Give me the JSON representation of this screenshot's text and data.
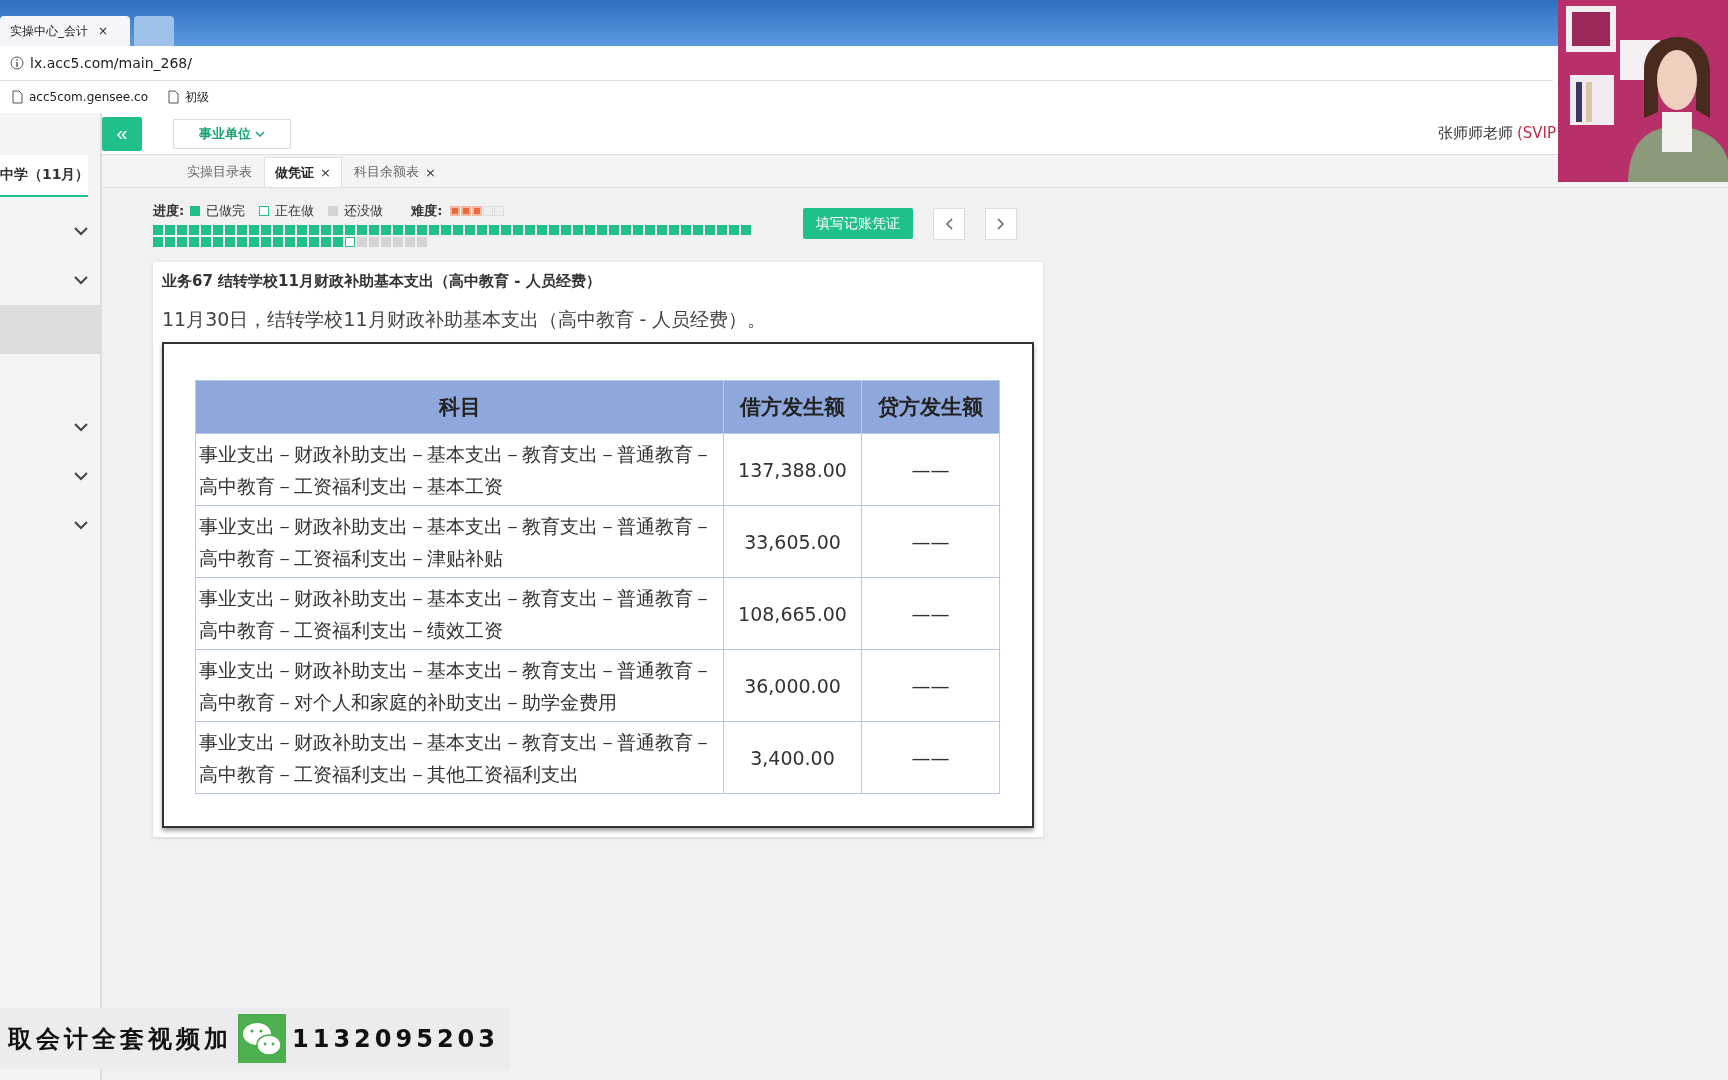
{
  "browser": {
    "tabs": [
      {
        "title": "实操中心_会计",
        "close": "×",
        "selected": true
      },
      {
        "selected": false
      }
    ],
    "address": "lx.acc5.com/main_268/",
    "bookmarks": [
      {
        "label": "acc5com.gensee.co"
      },
      {
        "label": "初级"
      }
    ]
  },
  "header": {
    "collapse": "«",
    "unit_dropdown": "事业单位",
    "user": "张师师老师",
    "membership": "(SVIP"
  },
  "sidebar": {
    "title": "中学（11月）",
    "items": [
      {
        "kind": "group",
        "selected": false
      },
      {
        "kind": "group",
        "selected": false
      },
      {
        "kind": "plain",
        "selected": true
      },
      {
        "kind": "group",
        "selected": false
      },
      {
        "kind": "group",
        "selected": false
      },
      {
        "kind": "group",
        "selected": false
      }
    ]
  },
  "tabs": [
    {
      "label": "实操目录表",
      "selected": false
    },
    {
      "label": "做凭证",
      "close": "×",
      "selected": true
    },
    {
      "label": "科目余额表",
      "close": "×",
      "selected": false
    }
  ],
  "progress": {
    "label": "进度:",
    "legend": [
      {
        "kind": "done",
        "label": "已做完"
      },
      {
        "kind": "current",
        "label": "正在做"
      },
      {
        "kind": "todo",
        "label": "还没做"
      }
    ],
    "difficulty_label": "难度:",
    "stars": 3,
    "squares": [
      {
        "kind": "done"
      },
      {
        "kind": "done"
      },
      {
        "kind": "done"
      },
      {
        "kind": "done"
      },
      {
        "kind": "done"
      },
      {
        "kind": "done"
      },
      {
        "kind": "done"
      },
      {
        "kind": "done"
      },
      {
        "kind": "done"
      },
      {
        "kind": "done"
      },
      {
        "kind": "done"
      },
      {
        "kind": "done"
      },
      {
        "kind": "done"
      },
      {
        "kind": "done"
      },
      {
        "kind": "done"
      },
      {
        "kind": "done"
      },
      {
        "kind": "done"
      },
      {
        "kind": "done"
      },
      {
        "kind": "done"
      },
      {
        "kind": "done"
      },
      {
        "kind": "done"
      },
      {
        "kind": "done"
      },
      {
        "kind": "done"
      },
      {
        "kind": "done"
      },
      {
        "kind": "done"
      },
      {
        "kind": "done"
      },
      {
        "kind": "done"
      },
      {
        "kind": "done"
      },
      {
        "kind": "done"
      },
      {
        "kind": "done"
      },
      {
        "kind": "done"
      },
      {
        "kind": "done"
      },
      {
        "kind": "done"
      },
      {
        "kind": "done"
      },
      {
        "kind": "done"
      },
      {
        "kind": "done"
      },
      {
        "kind": "done"
      },
      {
        "kind": "done"
      },
      {
        "kind": "done"
      },
      {
        "kind": "done"
      },
      {
        "kind": "done"
      },
      {
        "kind": "done"
      },
      {
        "kind": "done"
      },
      {
        "kind": "done"
      },
      {
        "kind": "done"
      },
      {
        "kind": "done"
      },
      {
        "kind": "done"
      },
      {
        "kind": "done"
      },
      {
        "kind": "done"
      },
      {
        "kind": "done"
      },
      {
        "kind": "done"
      },
      {
        "kind": "done"
      },
      {
        "kind": "done"
      },
      {
        "kind": "done"
      },
      {
        "kind": "done"
      },
      {
        "kind": "done"
      },
      {
        "kind": "done"
      },
      {
        "kind": "done"
      },
      {
        "kind": "done"
      },
      {
        "kind": "done"
      },
      {
        "kind": "done"
      },
      {
        "kind": "done"
      },
      {
        "kind": "done"
      },
      {
        "kind": "done"
      },
      {
        "kind": "done"
      },
      {
        "kind": "done"
      },
      {
        "kind": "current"
      },
      {
        "kind": "todo"
      },
      {
        "kind": "todo"
      },
      {
        "kind": "todo"
      },
      {
        "kind": "todo"
      },
      {
        "kind": "todo"
      },
      {
        "kind": "todo"
      }
    ]
  },
  "actions": {
    "fill_button": "填写记账凭证"
  },
  "task": {
    "title": "业务67 结转学校11月财政补助基本支出（高中教育 - 人员经费）",
    "description": "11月30日，结转学校11月财政补助基本支出（高中教育 - 人员经费）。",
    "table": {
      "columns": [
        "科目",
        "借方发生额",
        "贷方发生额"
      ],
      "rows": [
        {
          "account": "事业支出－财政补助支出－基本支出－教育支出－普通教育－高中教育－工资福利支出－基本工资",
          "debit": "137,388.00",
          "credit": "——"
        },
        {
          "account": "事业支出－财政补助支出－基本支出－教育支出－普通教育－高中教育－工资福利支出－津贴补贴",
          "debit": "33,605.00",
          "credit": "——"
        },
        {
          "account": "事业支出－财政补助支出－基本支出－教育支出－普通教育－高中教育－工资福利支出－绩效工资",
          "debit": "108,665.00",
          "credit": "——"
        },
        {
          "account": "事业支出－财政补助支出－基本支出－教育支出－普通教育－高中教育－对个人和家庭的补助支出－助学金费用",
          "debit": "36,000.00",
          "credit": "——"
        },
        {
          "account": "事业支出－财政补助支出－基本支出－教育支出－普通教育－高中教育－工资福利支出－其他工资福利支出",
          "debit": "3,400.00",
          "credit": "——"
        }
      ]
    }
  },
  "banner": {
    "text": "取会计全套视频加",
    "number": "1132095203"
  }
}
